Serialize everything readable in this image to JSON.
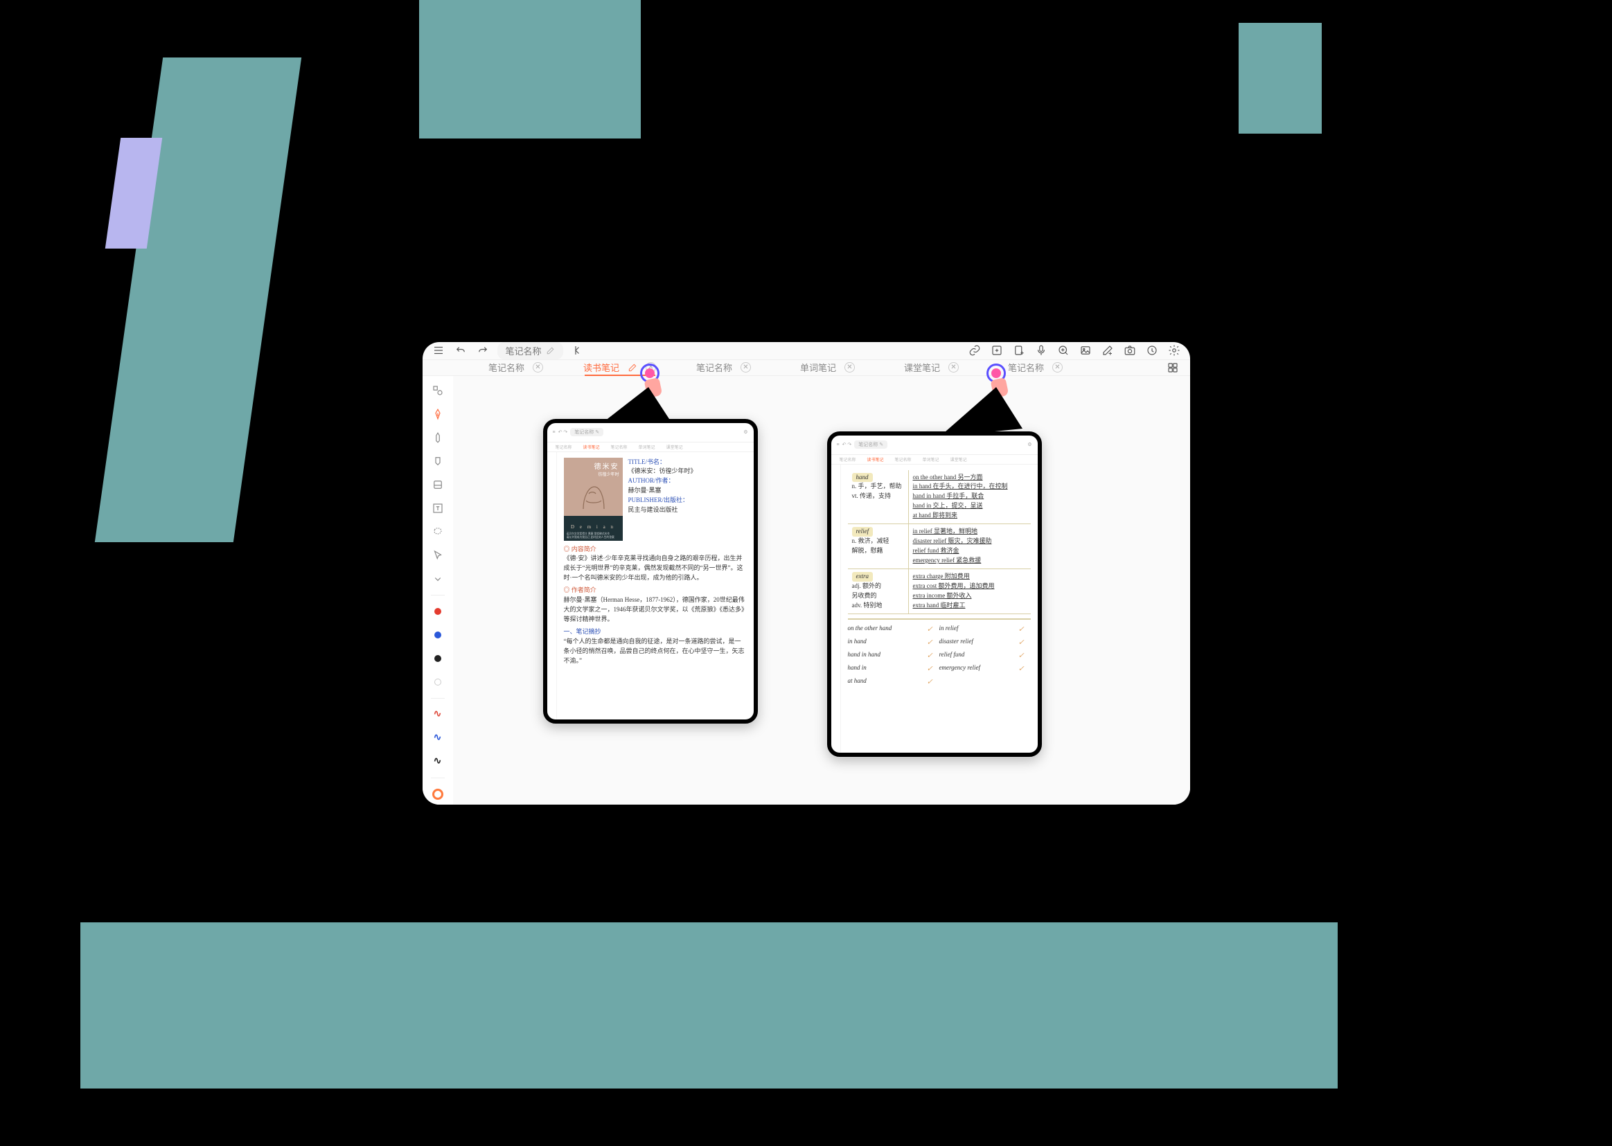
{
  "topbar": {
    "title": "笔记名称"
  },
  "tabs": [
    {
      "label": "笔记名称",
      "active": false,
      "editable": false
    },
    {
      "label": "读书笔记",
      "active": true,
      "editable": true
    },
    {
      "label": "笔记名称",
      "active": false,
      "editable": false
    },
    {
      "label": "单词笔记",
      "active": false,
      "editable": false
    },
    {
      "label": "课堂笔记",
      "active": false,
      "editable": false
    },
    {
      "label": "笔记名称",
      "active": false,
      "editable": false
    }
  ],
  "rail": {
    "colors": [
      "#e43b2f",
      "#2b58d9",
      "#222222",
      "#ffffff"
    ],
    "waves": [
      "#de4b3d",
      "#2b58d9",
      "#222222"
    ],
    "rings": [
      "#ff7a3d",
      "#7a4fff",
      "#f0b93a"
    ],
    "plus_color": "#ff6a3d"
  },
  "preview_reading": {
    "book_title_cn": "德米安",
    "book_subtitle_cn": "彷徨少年时",
    "fields": {
      "title_label": "TITLE/书名：",
      "title_value": "《德米安：彷徨少年时》",
      "author_label": "AUTHOR/作者：",
      "author_value": "赫尔曼·黑塞",
      "publisher_label": "PUBLISHER/出版社：",
      "publisher_value": "民主与建设出版社"
    },
    "sections": {
      "intro_heading": "◎ 内容简介",
      "intro_body": "《德·安》讲述·少年辛克莱寻找通向自身之路的艰辛历程，出生并成长于“光明世界”的辛克莱，偶然发现截然不同的“另一世界”。这时·一个名叫德米安的少年出现，成为他的引路人。",
      "author_heading": "◎ 作者简介",
      "author_body": "赫尔曼·黑塞（Herman Hesse，1877-1962），德国作家，20世纪最伟大的文学家之一，1946年获诺贝尔文学奖，以《荒原狼》《悉达多》等探讨精神世界。",
      "quote_heading": "一、笔记摘抄",
      "quote_body": "“每个人的生命都是通向自我的征途，是对一条道路的尝试，是一条小径的悄然召唤，品尝自己的终点何在，在心中坚守一生，矢志不渝。”"
    }
  },
  "preview_vocab": {
    "words": [
      {
        "head": "hand",
        "pos": [
          "n. 手，手艺，帮助",
          "vt. 传递，支持"
        ],
        "phrases": [
          "on the other hand  另一方面",
          "in hand  在手头，在进行中，在控制",
          "hand in hand  手拉手，联合",
          "hand in  交上，提交，呈送",
          "at hand  即将到来"
        ]
      },
      {
        "head": "relief",
        "pos": [
          "n. 救济，减轻",
          "解脱，慰藉"
        ],
        "phrases": [
          "in relief  显著地，鲜明地",
          "disaster relief  赈灾，灾难援助",
          "relief fund  救济金",
          "emergency relief  紧急救援"
        ]
      },
      {
        "head": "extra",
        "pos": [
          "adj. 额外的",
          "另收费的",
          "adv. 特别地"
        ],
        "phrases": [
          "extra charge  附加费用",
          "extra cost  额外费用，追加费用",
          "extra income  额外收入",
          "extra hand  临时雇工"
        ]
      }
    ],
    "summary": [
      [
        "on the other hand",
        "in relief"
      ],
      [
        "in hand",
        "disaster relief"
      ],
      [
        "hand in hand",
        "relief fund"
      ],
      [
        "hand in",
        "emergency relief"
      ],
      [
        "at hand",
        ""
      ]
    ]
  }
}
